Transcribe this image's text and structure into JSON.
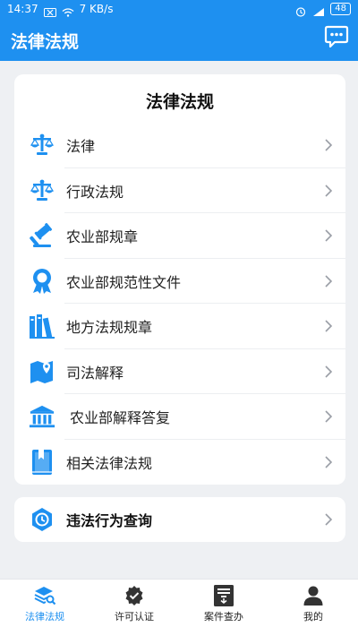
{
  "status_bar": {
    "time": "14:37",
    "network_speed": "7 KB/s",
    "battery": "48"
  },
  "app_bar": {
    "title": "法律法规",
    "message_icon": "chat-bubble-icon"
  },
  "card": {
    "title": "法律法规",
    "items": [
      {
        "label": "法律",
        "icon": "scales-icon"
      },
      {
        "label": "行政法规",
        "icon": "scales-icon"
      },
      {
        "label": "农业部规章",
        "icon": "gavel-icon"
      },
      {
        "label": "农业部规范性文件",
        "icon": "award-ribbon-icon"
      },
      {
        "label": "地方法规规章",
        "icon": "books-icon"
      },
      {
        "label": "司法解释",
        "icon": "map-pin-icon"
      },
      {
        "label": "农业部解释答复",
        "icon": "institution-icon"
      },
      {
        "label": "相关法律法规",
        "icon": "book-icon"
      }
    ]
  },
  "query_card": {
    "label": "违法行为查询",
    "icon": "clock-icon"
  },
  "bottom_nav": {
    "items": [
      {
        "label": "法律法规",
        "icon": "layers-search-icon",
        "active": true
      },
      {
        "label": "许可认证",
        "icon": "verified-shield-icon",
        "active": false
      },
      {
        "label": "案件查办",
        "icon": "document-icon",
        "active": false
      },
      {
        "label": "我的",
        "icon": "user-icon",
        "active": false
      }
    ]
  },
  "colors": {
    "primary": "#1e90f0",
    "background": "#eef0f3",
    "card": "#ffffff"
  }
}
